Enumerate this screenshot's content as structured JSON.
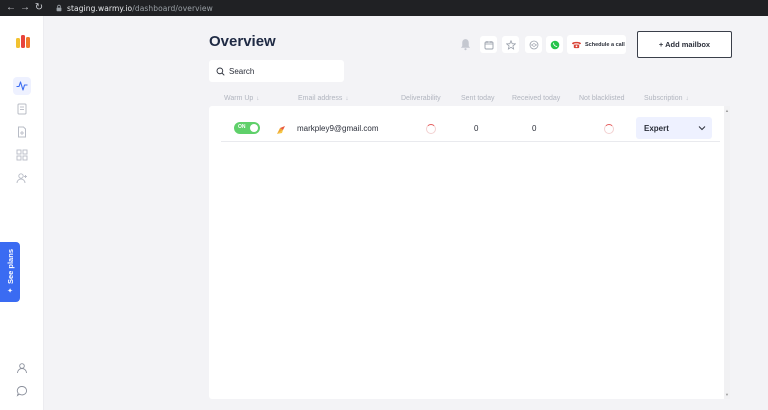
{
  "browser": {
    "back_icon": "arrow-left-icon",
    "forward_icon": "arrow-right-icon",
    "reload_icon": "reload-icon",
    "url_host": "staging.warmy.io",
    "url_path": "/dashboard/overview"
  },
  "sidebar": {
    "logo": "warmy-logo",
    "items": [
      {
        "icon": "activity-icon",
        "active": true
      },
      {
        "icon": "document-icon",
        "active": false
      },
      {
        "icon": "file-icon",
        "active": false
      },
      {
        "icon": "apps-grid-icon",
        "active": false
      },
      {
        "icon": "user-add-icon",
        "active": false
      }
    ],
    "bottom": [
      {
        "icon": "user-icon"
      },
      {
        "icon": "chat-icon"
      }
    ],
    "see_plans": "See plans"
  },
  "header": {
    "title": "Overview",
    "search_placeholder": "Search",
    "schedule_label": "Schedule a call",
    "add_mailbox": "+ Add mailbox",
    "icons": [
      "bell-icon",
      "calendar-icon",
      "star-icon",
      "graduation-cap-icon",
      "whatsapp-icon",
      "phone-icon"
    ]
  },
  "table": {
    "columns": [
      "Warm Up",
      "Email address",
      "Deliverability",
      "Sent today",
      "Received today",
      "Not blacklisted",
      "Subscription"
    ],
    "rows": [
      {
        "warmup": "ON",
        "email": "markpley9@gmail.com",
        "sent_today": "0",
        "received_today": "0",
        "subscription": "Expert"
      }
    ]
  },
  "colors": {
    "accent": "#3a6bf2",
    "toggle_on": "#5fd06a",
    "spinner": "#e45a5a",
    "background": "#f3f3f6"
  }
}
